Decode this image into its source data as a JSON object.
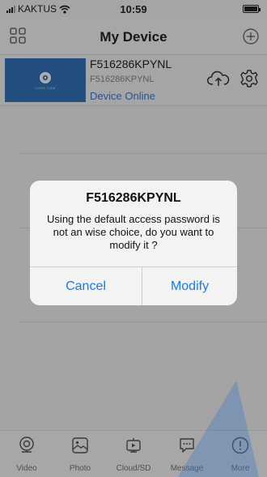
{
  "status_bar": {
    "carrier": "KAKTUS",
    "time": "10:59"
  },
  "nav": {
    "title": "My Device",
    "left_icon": "grid-icon",
    "right_icon": "add-circle-icon"
  },
  "device": {
    "name": "F516286KPYNL",
    "id": "F516286KPYNL",
    "status": "Device Online",
    "thumbnail_brand": "LOOK CAM"
  },
  "dialog": {
    "title": "F516286KPYNL",
    "message": "Using the default access password is not an wise choice, do you want to modify it ?",
    "cancel_label": "Cancel",
    "modify_label": "Modify"
  },
  "tabs": [
    {
      "label": "Video",
      "icon": "webcam-icon"
    },
    {
      "label": "Photo",
      "icon": "photo-icon"
    },
    {
      "label": "Cloud/SD",
      "icon": "cloud-sd-icon"
    },
    {
      "label": "Message",
      "icon": "message-icon"
    },
    {
      "label": "More",
      "icon": "more-icon"
    }
  ],
  "colors": {
    "accent": "#1a7ae0",
    "thumbnail": "#3475bd"
  }
}
